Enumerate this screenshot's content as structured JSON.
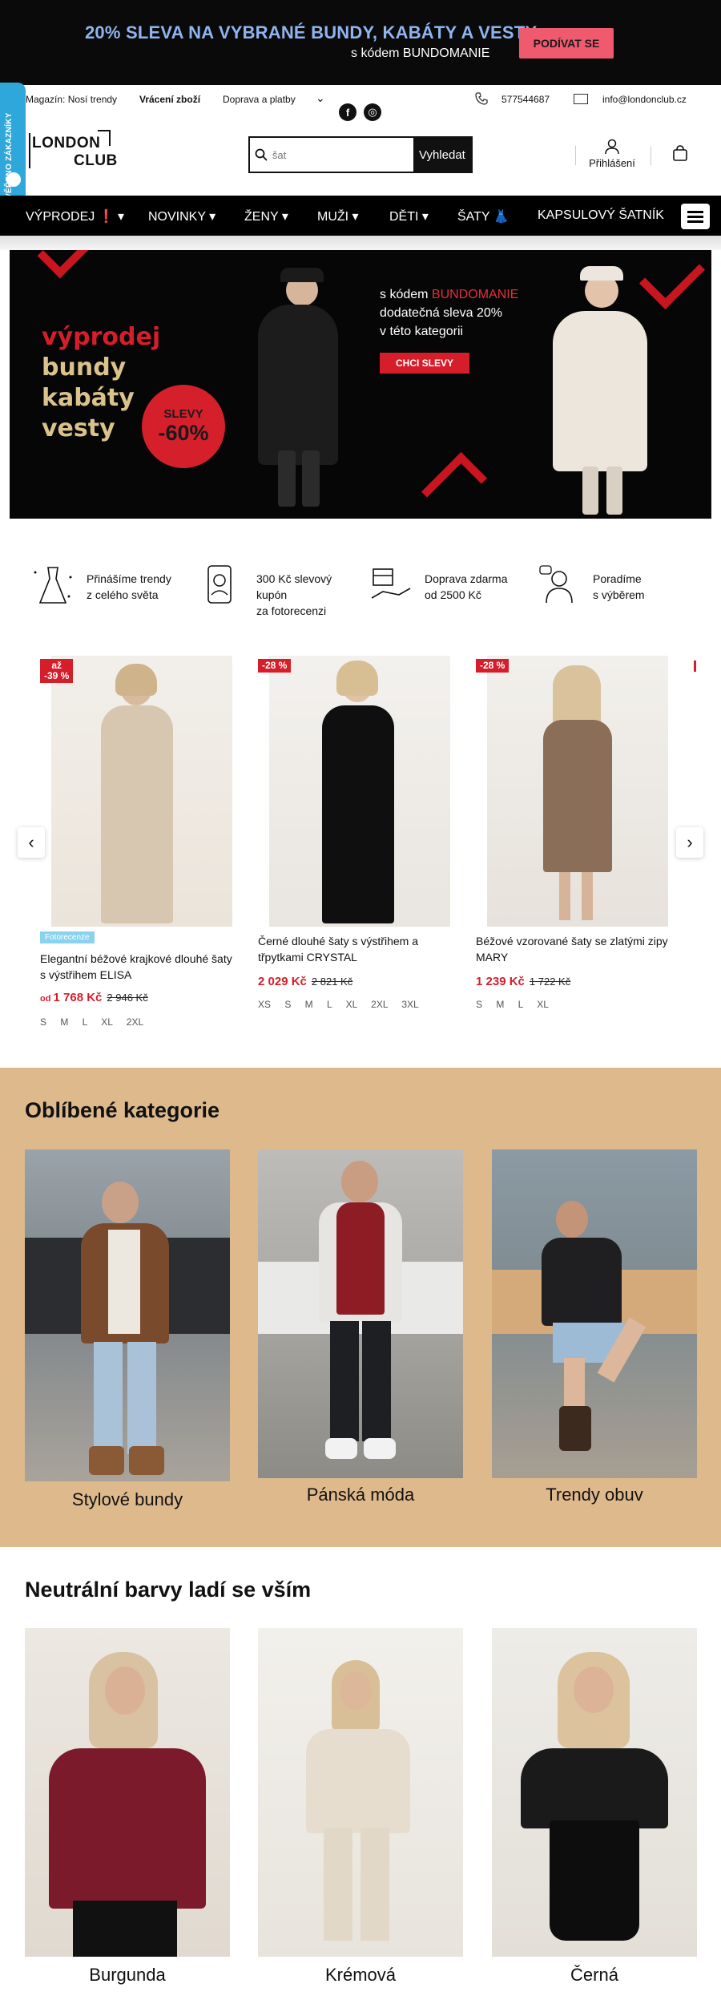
{
  "promo": {
    "headline": "20% SLEVA NA VYBRANÉ BUNDY, KABÁTY A VESTY",
    "sub": "s kódem BUNDOMANIE",
    "button": "PODÍVAT SE"
  },
  "badge": {
    "text": "OVĚŘENO ZÁKAZNÍKY"
  },
  "util": {
    "magazine": "Magazín: Nosí trendy",
    "returns": "Vrácení zboží",
    "shipping": "Doprava a platby",
    "phone": "577544687",
    "email": "info@londonclub.cz",
    "facebook_glyph": "f",
    "instagram_glyph": "◎"
  },
  "header": {
    "logo_line1": "LONDON",
    "logo_line2": "CLUB",
    "search_placeholder": "šat",
    "search_button": "Vyhledat",
    "login": "Přihlášení"
  },
  "nav": {
    "items": [
      "VÝPRODEJ ❗ ▾",
      "NOVINKY ▾",
      "ŽENY ▾",
      "MUŽI ▾",
      "DĚTI ▾",
      "ŠATY 👗",
      "KAPSULOVÝ ŠATNÍK"
    ]
  },
  "hero": {
    "line1": "výprodej",
    "line2": "bundy",
    "line3": "kabáty",
    "line4": "vesty",
    "circle_top": "SLEVY",
    "circle_big": "-60%",
    "copy_prefix": "s kódem ",
    "copy_code": "BUNDOMANIE",
    "copy_line2": "dodatečná sleva 20%",
    "copy_line3": "v této kategorii",
    "button": "CHCI SLEVY"
  },
  "features": [
    {
      "icon": "dress-icon",
      "text": "Přinášíme trendy\nz celého světa"
    },
    {
      "icon": "coupon-icon",
      "text": "300 Kč slevový\nkupón\nza fotorecenzi"
    },
    {
      "icon": "delivery-icon",
      "text": "Doprava zdarma\nod 2500 Kč"
    },
    {
      "icon": "advisor-icon",
      "text": "Poradíme\ns výběrem"
    }
  ],
  "products": [
    {
      "discount_prefix": "až",
      "discount": "-39 %",
      "tag": "Fotorecenze",
      "name": "Elegantní béžové krajkové dlouhé šaty s výstřihem ELISA",
      "price_prefix": "od ",
      "price": "1 768 Kč",
      "old_price": "2 946 Kč",
      "sizes": "S M L XL 2XL"
    },
    {
      "discount": "-28 %",
      "name": "Černé dlouhé šaty s výstřihem a třpytkami CRYSTAL",
      "price": "2 029 Kč",
      "old_price": "2 821 Kč",
      "sizes": "XS S M L XL 2XL 3XL"
    },
    {
      "discount": "-28 %",
      "name": "Béžové vzorované šaty se zlatými zipy MARY",
      "price": "1 239 Kč",
      "old_price": "1 722 Kč",
      "sizes": "S M L XL"
    }
  ],
  "categories": {
    "title": "Oblíbené kategorie",
    "items": [
      "Stylové bundy",
      "Pánská móda",
      "Trendy obuv"
    ]
  },
  "neutral": {
    "title": "Neutrální barvy ladí se vším",
    "items": [
      "Burgunda",
      "Krémová",
      "Černá"
    ]
  },
  "colors": {
    "promo_bg": "#0a0a0a",
    "promo_head": "#8fb5f0",
    "promo_btn": "#ef5a6f",
    "accent_red": "#d51e2a",
    "badge_blue": "#2fa7da",
    "category_bg": "#ddb98c"
  }
}
